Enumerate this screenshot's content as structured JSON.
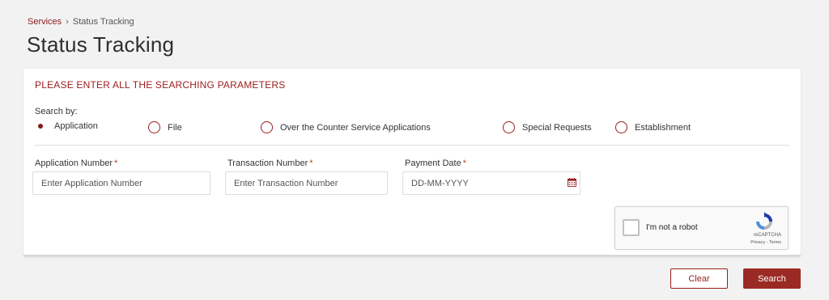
{
  "breadcrumb": {
    "link": "Services",
    "separator": "›",
    "current": "Status Tracking"
  },
  "page_title": "Status Tracking",
  "form": {
    "heading": "PLEASE ENTER ALL THE SEARCHING PARAMETERS",
    "search_by_label": "Search by:",
    "search_options": [
      {
        "label": "Application",
        "selected": true
      },
      {
        "label": "File",
        "selected": false
      },
      {
        "label": "Over the Counter Service Applications",
        "selected": false
      },
      {
        "label": "Special Requests",
        "selected": false
      },
      {
        "label": "Establishment",
        "selected": false
      }
    ],
    "fields": {
      "application_number": {
        "label": "Application Number",
        "required_mark": "*",
        "placeholder": "Enter Application Number",
        "value": ""
      },
      "transaction_number": {
        "label": "Transaction Number",
        "required_mark": "*",
        "placeholder": "Enter Transaction Number",
        "value": ""
      },
      "payment_date": {
        "label": "Payment Date",
        "required_mark": "*",
        "placeholder": "DD-MM-YYYY",
        "value": "",
        "icon": "calendar-icon"
      }
    },
    "captcha": {
      "label": "I'm not a robot",
      "brand": "reCAPTCHA",
      "links": "Privacy - Terms"
    }
  },
  "actions": {
    "clear_label": "Clear",
    "search_label": "Search"
  },
  "colors": {
    "accent": "#9b1c1c",
    "button_primary": "#9b2a24",
    "background": "#f2f2f2"
  }
}
